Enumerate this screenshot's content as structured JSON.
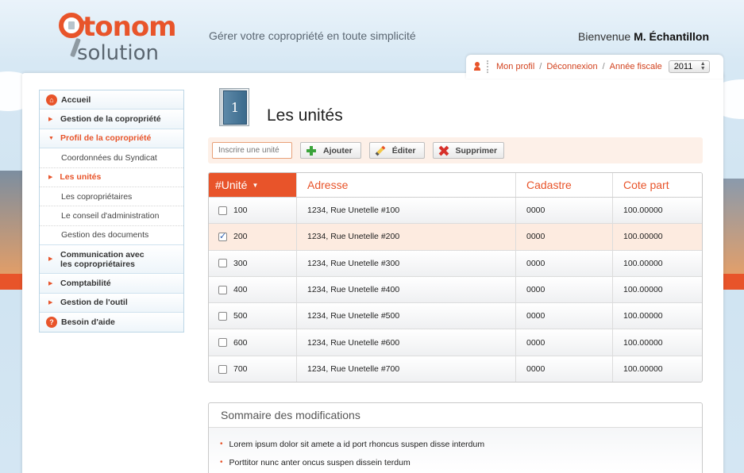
{
  "header": {
    "logo_word1": "tonom",
    "logo_word2": "solution",
    "tagline": "Gérer votre copropriété en toute simplicité",
    "welcome_prefix": "Bienvenue ",
    "welcome_name": "M. Échantillon"
  },
  "utility": {
    "profile": "Mon profil",
    "logout": "Déconnexion",
    "fiscal_year_label": "Année fiscale",
    "fiscal_year_value": "2011",
    "separator": "/"
  },
  "sidebar": {
    "items": [
      {
        "label": "Accueil"
      },
      {
        "label": "Gestion de la copropriété"
      },
      {
        "label": "Profil de la copropriété"
      },
      {
        "label": "Coordonnées du Syndicat"
      },
      {
        "label": "Les unités"
      },
      {
        "label": "Les copropriétaires"
      },
      {
        "label": "Le conseil d'administration"
      },
      {
        "label": "Gestion des documents"
      },
      {
        "label": "Communication avec"
      },
      {
        "label": "les copropriétaires"
      },
      {
        "label": "Comptabilité"
      },
      {
        "label": "Gestion de l'outil"
      },
      {
        "label": "Besoin d'aide"
      }
    ]
  },
  "page": {
    "door_number": "1",
    "title": "Les unités"
  },
  "toolbar": {
    "search_placeholder": "Inscrire une unité",
    "add": "Ajouter",
    "edit": "Éditer",
    "delete": "Supprimer"
  },
  "table": {
    "headers": [
      "#Unité",
      "Adresse",
      "Cadastre",
      "Cote part"
    ],
    "rows": [
      {
        "unit": "100",
        "address": "1234, Rue Unetelle #100",
        "cadastre": "0000",
        "share": "100.00000",
        "checked": false
      },
      {
        "unit": "200",
        "address": "1234, Rue Unetelle #200",
        "cadastre": "0000",
        "share": "100.00000",
        "checked": true
      },
      {
        "unit": "300",
        "address": "1234, Rue Unetelle #300",
        "cadastre": "0000",
        "share": "100.00000",
        "checked": false
      },
      {
        "unit": "400",
        "address": "1234, Rue Unetelle #400",
        "cadastre": "0000",
        "share": "100.00000",
        "checked": false
      },
      {
        "unit": "500",
        "address": "1234, Rue Unetelle #500",
        "cadastre": "0000",
        "share": "100.00000",
        "checked": false
      },
      {
        "unit": "600",
        "address": "1234, Rue Unetelle #600",
        "cadastre": "0000",
        "share": "100.00000",
        "checked": false
      },
      {
        "unit": "700",
        "address": "1234, Rue Unetelle #700",
        "cadastre": "0000",
        "share": "100.00000",
        "checked": false
      }
    ]
  },
  "summary": {
    "title": "Sommaire des modifications",
    "items": [
      "Lorem ipsum dolor sit amete a id port rhoncus suspen disse interdum",
      "Porttitor nunc anter oncus suspen dissein terdum"
    ]
  },
  "colors": {
    "accent": "#e8542a",
    "selected_row": "#fdebe0",
    "toolbar_bg": "#fdf0e8"
  }
}
